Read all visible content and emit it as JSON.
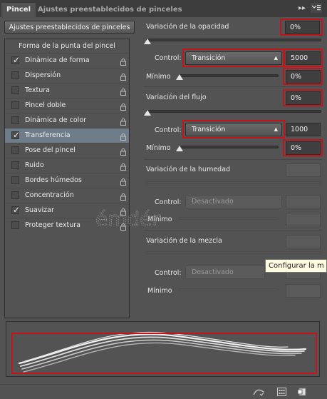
{
  "tabs": {
    "active": "Pincel",
    "inactive": "Ajustes preestablecidos de pinceles"
  },
  "header_icons": {
    "collapse": "double-arrow-icon",
    "menu": "panel-menu-icon"
  },
  "presets_button": "Ajustes preestablecidos de pinceles",
  "list": {
    "header": "Forma de la punta del pincel",
    "items": [
      {
        "label": "Dinámica de forma",
        "checked": true,
        "selected": false
      },
      {
        "label": "Dispersión",
        "checked": false,
        "selected": false
      },
      {
        "label": "Textura",
        "checked": false,
        "selected": false
      },
      {
        "label": "Pincel doble",
        "checked": false,
        "selected": false
      },
      {
        "label": "Dinámica de color",
        "checked": false,
        "selected": false
      },
      {
        "label": "Transferencia",
        "checked": true,
        "selected": true
      },
      {
        "label": "Pose del pincel",
        "checked": false,
        "selected": false
      },
      {
        "label": "Ruido",
        "checked": false,
        "selected": false
      },
      {
        "label": "Bordes húmedos",
        "checked": false,
        "selected": false
      },
      {
        "label": "Concentración",
        "checked": false,
        "selected": false
      },
      {
        "label": "Suavizar",
        "checked": true,
        "selected": false
      },
      {
        "label": "Proteger textura",
        "checked": false,
        "selected": false
      }
    ]
  },
  "opacity": {
    "title": "Variación de la opacidad",
    "value": "0%",
    "control_label": "Control:",
    "control_value": "Transición",
    "steps": "5000",
    "min_label": "Mínimo",
    "min_value": "0%"
  },
  "flow": {
    "title": "Variación del flujo",
    "value": "0%",
    "control_label": "Control:",
    "control_value": "Transición",
    "steps": "1000",
    "min_label": "Mínimo",
    "min_value": "0%"
  },
  "wetness": {
    "title": "Variación de la humedad",
    "control_label": "Control:",
    "control_value": "Desactivado",
    "min_label": "Mínimo"
  },
  "mix": {
    "title": "Variación de la mezcla",
    "control_label": "Control:",
    "control_value": "Desactivado",
    "min_label": "Mínimo"
  },
  "tooltip": "Configurar la m",
  "watermark": "émdér",
  "colors": {
    "highlight_red": "#c2141a",
    "selected_row": "#6f7d8b",
    "panel_bg": "#535353"
  }
}
